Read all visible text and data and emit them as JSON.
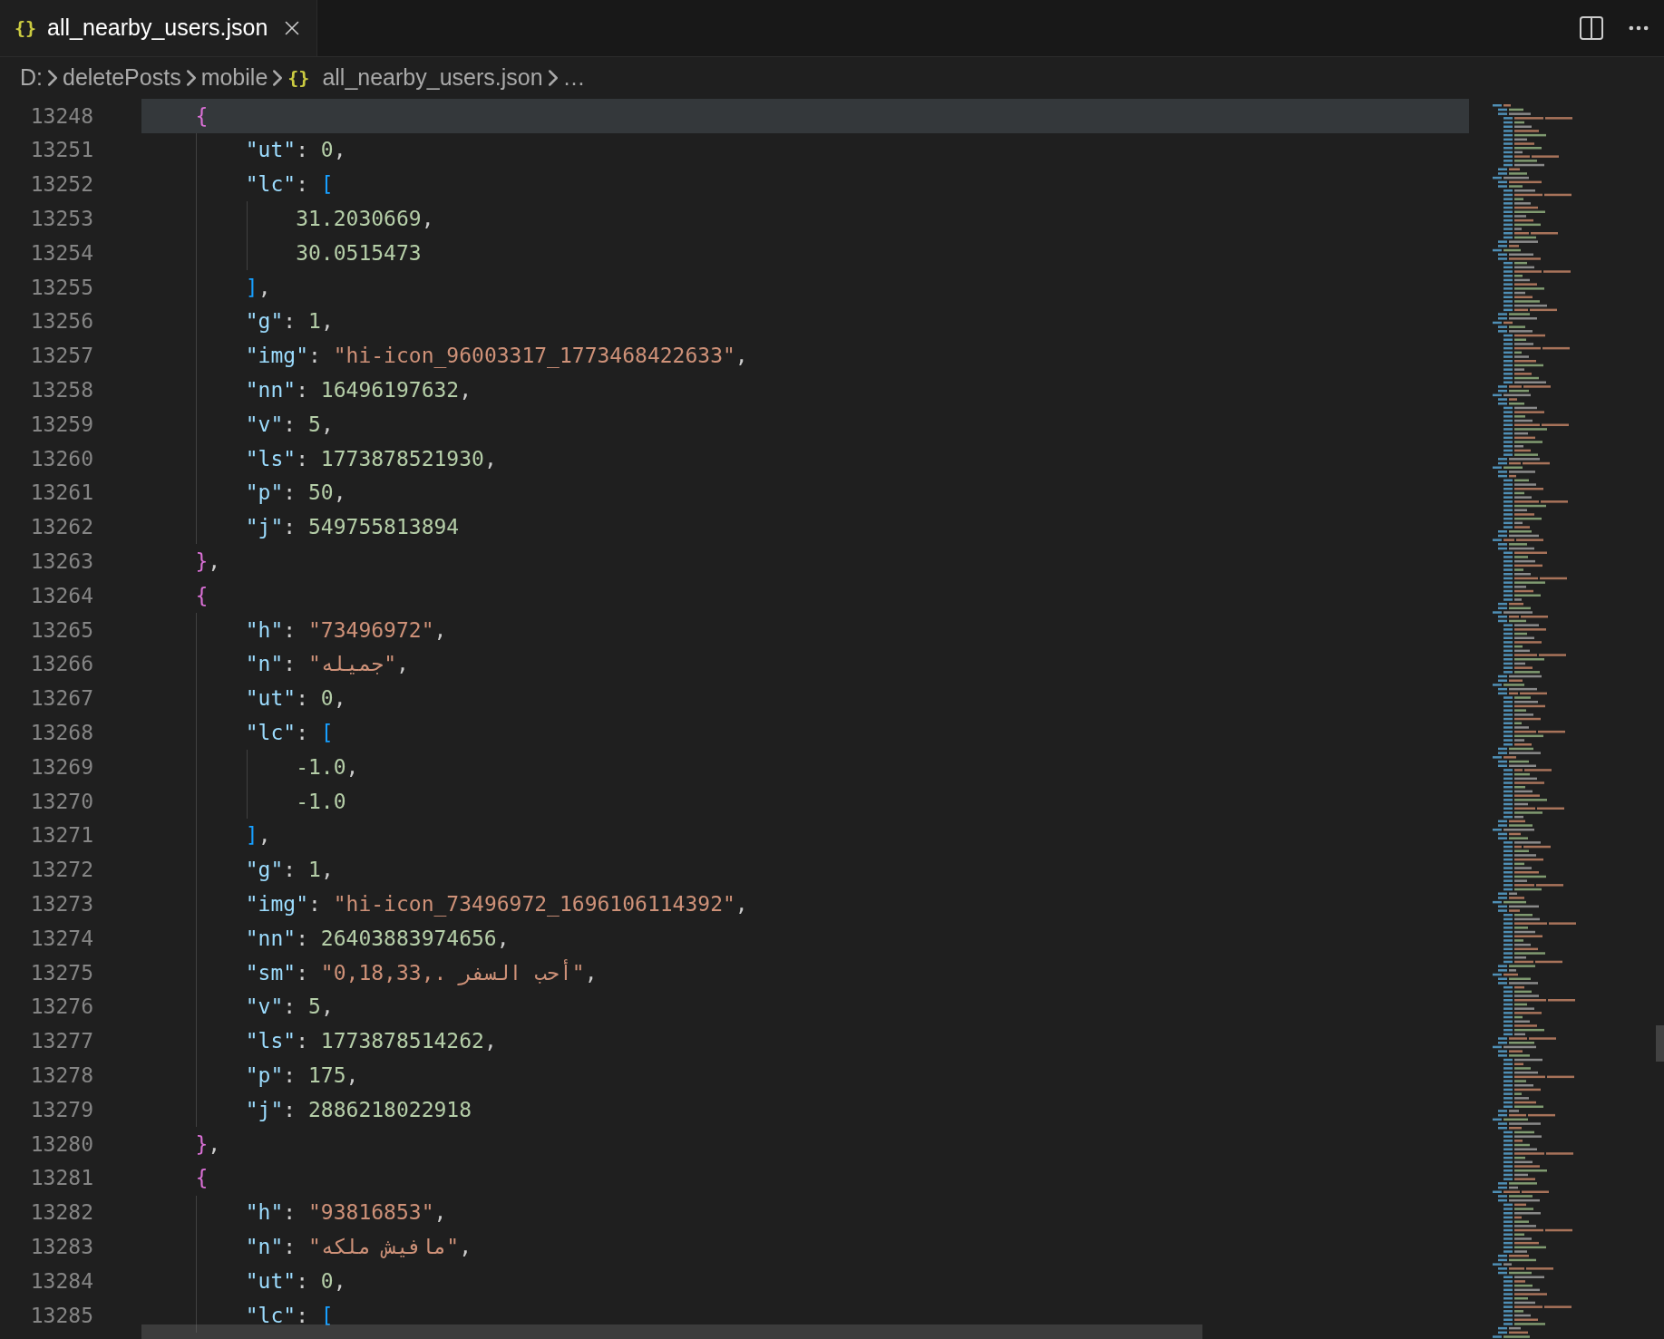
{
  "tab": {
    "icon": "{}",
    "label": "all_nearby_users.json",
    "selected": true
  },
  "breadcrumbs": {
    "items": [
      {
        "text": "D:"
      },
      {
        "text": "deletePosts"
      },
      {
        "text": "mobile"
      },
      {
        "icon": "{}",
        "text": "all_nearby_users.json"
      },
      {
        "text": "…"
      }
    ]
  },
  "editor": {
    "lines": [
      {
        "number": "13248",
        "current": true,
        "tokens": [
          {
            "kind": "brace",
            "text": "{"
          }
        ],
        "children": [
          {
            "number": "13251",
            "current": false,
            "tokens": [
              {
                "kind": "key",
                "text": "\"ut\""
              },
              {
                "kind": "punct",
                "text": ": "
              },
              {
                "kind": "number",
                "text": "0"
              },
              {
                "kind": "punct",
                "text": ","
              }
            ]
          },
          {
            "number": "13252",
            "current": false,
            "tokens": [
              {
                "kind": "key",
                "text": "\"lc\""
              },
              {
                "kind": "punct",
                "text": ": "
              },
              {
                "kind": "bracket",
                "text": "["
              }
            ],
            "children": [
              {
                "number": "13253",
                "current": false,
                "tokens": [
                  {
                    "kind": "number",
                    "text": "31.2030669"
                  },
                  {
                    "kind": "punct",
                    "text": ","
                  }
                ]
              },
              {
                "number": "13254",
                "current": false,
                "tokens": [
                  {
                    "kind": "number",
                    "text": "30.0515473"
                  }
                ]
              }
            ]
          },
          {
            "number": "13255",
            "current": false,
            "tokens": [
              {
                "kind": "bracket",
                "text": "]"
              },
              {
                "kind": "punct",
                "text": ","
              }
            ]
          },
          {
            "number": "13256",
            "current": false,
            "tokens": [
              {
                "kind": "key",
                "text": "\"g\""
              },
              {
                "kind": "punct",
                "text": ": "
              },
              {
                "kind": "number",
                "text": "1"
              },
              {
                "kind": "punct",
                "text": ","
              }
            ]
          },
          {
            "number": "13257",
            "current": false,
            "tokens": [
              {
                "kind": "key",
                "text": "\"img\""
              },
              {
                "kind": "punct",
                "text": ": "
              },
              {
                "kind": "string",
                "text": "\"hi-icon_96003317_1773468422633\""
              },
              {
                "kind": "punct",
                "text": ","
              }
            ]
          },
          {
            "number": "13258",
            "current": false,
            "tokens": [
              {
                "kind": "key",
                "text": "\"nn\""
              },
              {
                "kind": "punct",
                "text": ": "
              },
              {
                "kind": "number",
                "text": "16496197632"
              },
              {
                "kind": "punct",
                "text": ","
              }
            ]
          },
          {
            "number": "13259",
            "current": false,
            "tokens": [
              {
                "kind": "key",
                "text": "\"v\""
              },
              {
                "kind": "punct",
                "text": ": "
              },
              {
                "kind": "number",
                "text": "5"
              },
              {
                "kind": "punct",
                "text": ","
              }
            ]
          },
          {
            "number": "13260",
            "current": false,
            "tokens": [
              {
                "kind": "key",
                "text": "\"ls\""
              },
              {
                "kind": "punct",
                "text": ": "
              },
              {
                "kind": "number",
                "text": "1773878521930"
              },
              {
                "kind": "punct",
                "text": ","
              }
            ]
          },
          {
            "number": "13261",
            "current": false,
            "tokens": [
              {
                "kind": "key",
                "text": "\"p\""
              },
              {
                "kind": "punct",
                "text": ": "
              },
              {
                "kind": "number",
                "text": "50"
              },
              {
                "kind": "punct",
                "text": ","
              }
            ]
          },
          {
            "number": "13262",
            "current": false,
            "tokens": [
              {
                "kind": "key",
                "text": "\"j\""
              },
              {
                "kind": "punct",
                "text": ": "
              },
              {
                "kind": "number",
                "text": "549755813894"
              }
            ]
          }
        ]
      },
      {
        "number": "13263",
        "current": false,
        "tokens": [
          {
            "kind": "brace",
            "text": "}"
          },
          {
            "kind": "punct",
            "text": ","
          }
        ]
      },
      {
        "number": "13264",
        "current": false,
        "tokens": [
          {
            "kind": "brace",
            "text": "{"
          }
        ],
        "children": [
          {
            "number": "13265",
            "current": false,
            "tokens": [
              {
                "kind": "key",
                "text": "\"h\""
              },
              {
                "kind": "punct",
                "text": ": "
              },
              {
                "kind": "string",
                "text": "\"73496972\""
              },
              {
                "kind": "punct",
                "text": ","
              }
            ]
          },
          {
            "number": "13266",
            "current": false,
            "tokens": [
              {
                "kind": "key",
                "text": "\"n\""
              },
              {
                "kind": "punct",
                "text": ": "
              },
              {
                "kind": "string",
                "text": "\"جميله\""
              },
              {
                "kind": "punct",
                "text": ","
              }
            ]
          },
          {
            "number": "13267",
            "current": false,
            "tokens": [
              {
                "kind": "key",
                "text": "\"ut\""
              },
              {
                "kind": "punct",
                "text": ": "
              },
              {
                "kind": "number",
                "text": "0"
              },
              {
                "kind": "punct",
                "text": ","
              }
            ]
          },
          {
            "number": "13268",
            "current": false,
            "tokens": [
              {
                "kind": "key",
                "text": "\"lc\""
              },
              {
                "kind": "punct",
                "text": ": "
              },
              {
                "kind": "bracket",
                "text": "["
              }
            ],
            "children": [
              {
                "number": "13269",
                "current": false,
                "tokens": [
                  {
                    "kind": "number",
                    "text": "-1.0"
                  },
                  {
                    "kind": "punct",
                    "text": ","
                  }
                ]
              },
              {
                "number": "13270",
                "current": false,
                "tokens": [
                  {
                    "kind": "number",
                    "text": "-1.0"
                  }
                ]
              }
            ]
          },
          {
            "number": "13271",
            "current": false,
            "tokens": [
              {
                "kind": "bracket",
                "text": "]"
              },
              {
                "kind": "punct",
                "text": ","
              }
            ]
          },
          {
            "number": "13272",
            "current": false,
            "tokens": [
              {
                "kind": "key",
                "text": "\"g\""
              },
              {
                "kind": "punct",
                "text": ": "
              },
              {
                "kind": "number",
                "text": "1"
              },
              {
                "kind": "punct",
                "text": ","
              }
            ]
          },
          {
            "number": "13273",
            "current": false,
            "tokens": [
              {
                "kind": "key",
                "text": "\"img\""
              },
              {
                "kind": "punct",
                "text": ": "
              },
              {
                "kind": "string",
                "text": "\"hi-icon_73496972_1696106114392\""
              },
              {
                "kind": "punct",
                "text": ","
              }
            ]
          },
          {
            "number": "13274",
            "current": false,
            "tokens": [
              {
                "kind": "key",
                "text": "\"nn\""
              },
              {
                "kind": "punct",
                "text": ": "
              },
              {
                "kind": "number",
                "text": "26403883974656"
              },
              {
                "kind": "punct",
                "text": ","
              }
            ]
          },
          {
            "number": "13275",
            "current": false,
            "tokens": [
              {
                "kind": "key",
                "text": "\"sm\""
              },
              {
                "kind": "punct",
                "text": ": "
              },
              {
                "kind": "string",
                "text": "\"0,18,33,. أحب السفر\""
              },
              {
                "kind": "punct",
                "text": ","
              }
            ]
          },
          {
            "number": "13276",
            "current": false,
            "tokens": [
              {
                "kind": "key",
                "text": "\"v\""
              },
              {
                "kind": "punct",
                "text": ": "
              },
              {
                "kind": "number",
                "text": "5"
              },
              {
                "kind": "punct",
                "text": ","
              }
            ]
          },
          {
            "number": "13277",
            "current": false,
            "tokens": [
              {
                "kind": "key",
                "text": "\"ls\""
              },
              {
                "kind": "punct",
                "text": ": "
              },
              {
                "kind": "number",
                "text": "1773878514262"
              },
              {
                "kind": "punct",
                "text": ","
              }
            ]
          },
          {
            "number": "13278",
            "current": false,
            "tokens": [
              {
                "kind": "key",
                "text": "\"p\""
              },
              {
                "kind": "punct",
                "text": ": "
              },
              {
                "kind": "number",
                "text": "175"
              },
              {
                "kind": "punct",
                "text": ","
              }
            ]
          },
          {
            "number": "13279",
            "current": false,
            "tokens": [
              {
                "kind": "key",
                "text": "\"j\""
              },
              {
                "kind": "punct",
                "text": ": "
              },
              {
                "kind": "number",
                "text": "2886218022918"
              }
            ]
          }
        ]
      },
      {
        "number": "13280",
        "current": false,
        "tokens": [
          {
            "kind": "brace",
            "text": "}"
          },
          {
            "kind": "punct",
            "text": ","
          }
        ]
      },
      {
        "number": "13281",
        "current": false,
        "tokens": [
          {
            "kind": "brace",
            "text": "{"
          }
        ],
        "children": [
          {
            "number": "13282",
            "current": false,
            "tokens": [
              {
                "kind": "key",
                "text": "\"h\""
              },
              {
                "kind": "punct",
                "text": ": "
              },
              {
                "kind": "string",
                "text": "\"93816853\""
              },
              {
                "kind": "punct",
                "text": ","
              }
            ]
          },
          {
            "number": "13283",
            "current": false,
            "tokens": [
              {
                "kind": "key",
                "text": "\"n\""
              },
              {
                "kind": "punct",
                "text": ": "
              },
              {
                "kind": "string",
                "text": "\"مافيش ملكه\""
              },
              {
                "kind": "punct",
                "text": ","
              }
            ]
          },
          {
            "number": "13284",
            "current": false,
            "tokens": [
              {
                "kind": "key",
                "text": "\"ut\""
              },
              {
                "kind": "punct",
                "text": ": "
              },
              {
                "kind": "number",
                "text": "0"
              },
              {
                "kind": "punct",
                "text": ","
              }
            ]
          },
          {
            "number": "13285",
            "current": false,
            "tokens": [
              {
                "kind": "key",
                "text": "\"lc\""
              },
              {
                "kind": "punct",
                "text": ": "
              },
              {
                "kind": "bracket",
                "text": "["
              }
            ]
          }
        ]
      }
    ]
  }
}
